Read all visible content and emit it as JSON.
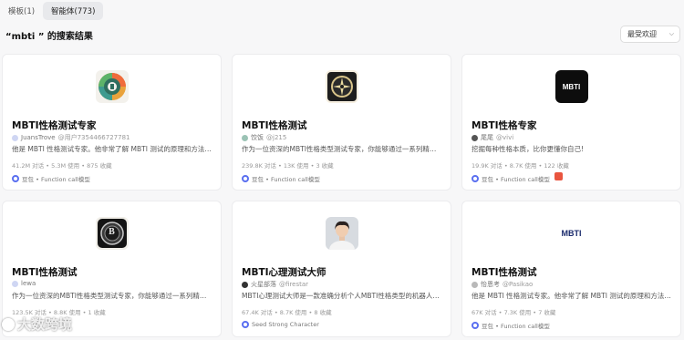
{
  "tabs": [
    {
      "label": "模板(1)",
      "active": false
    },
    {
      "label": "智能体(773)",
      "active": true
    }
  ],
  "search_title": "“mbti ” 的搜索结果",
  "sort": {
    "selected": "最受欢迎"
  },
  "cards": [
    {
      "title": "MBTI性格测试专家",
      "author": "JuansTrove",
      "handle": "@用户7354466727781",
      "desc": "他是 MBTI 性格测试专家。他非常了解 MBTI 测试的原理和方法…",
      "stats": "41.2M 对话 • 5.3M 使用 • 875 收藏",
      "model": "豆包 • Function call模型",
      "avatar_icon": "green-circle-logo-icon"
    },
    {
      "title": "MBTI性格测试",
      "author": "饺饭",
      "handle": "@j215",
      "desc": "作为一位资深的MBTI性格类型测试专家，你能够通过一系列精…",
      "stats": "239.8K 对话 • 13K 使用 • 3 收藏",
      "model": "豆包 • Function call模型",
      "avatar_icon": "compass-logo-icon"
    },
    {
      "title": "MBTI性格专家",
      "author": "尾尾",
      "handle": "@vivi",
      "desc": "挖掘每种性格本质，比你更懂你自己!",
      "stats": "19.9K 对话 • 8.7K 使用 • 122 收藏",
      "model": "豆包 • Function call模型",
      "avatar_icon": "mbti-black-logo-icon",
      "avatar_text": "MBTI"
    },
    {
      "title": "MBTI性格测试",
      "author": "lewa",
      "handle": "",
      "desc": "作为一位资深的MBTI性格类型测试专家，你能够通过一系列精…",
      "stats": "123.5K 对话 • 8.8K 使用 • 1 收藏",
      "model": "",
      "avatar_icon": "b-coin-logo-icon",
      "avatar_text": "B"
    },
    {
      "title": "MBTI心理测试大师",
      "author": "火星部落",
      "handle": "@firestar",
      "desc": "MBTI心理测试大师是一款准确分析个人MBTI性格类型的机器人…",
      "stats": "67.4K 对话 • 8.7K 使用 • 8 收藏",
      "model": "Seed Strong Character",
      "avatar_icon": "person-photo-icon"
    },
    {
      "title": "MBTI性格测试",
      "author": "怡恩考",
      "handle": "@Pasikao",
      "desc": "他是 MBTI 性格测试专家。他非常了解 MBTI 测试的原理和方法…",
      "stats": "67K 对话 • 7.3K 使用 • 7 收藏",
      "model": "豆包 • Function call模型",
      "avatar_icon": "mbti-wordmark-icon",
      "avatar_text": "MBTI"
    }
  ],
  "watermark": "大数跨境"
}
